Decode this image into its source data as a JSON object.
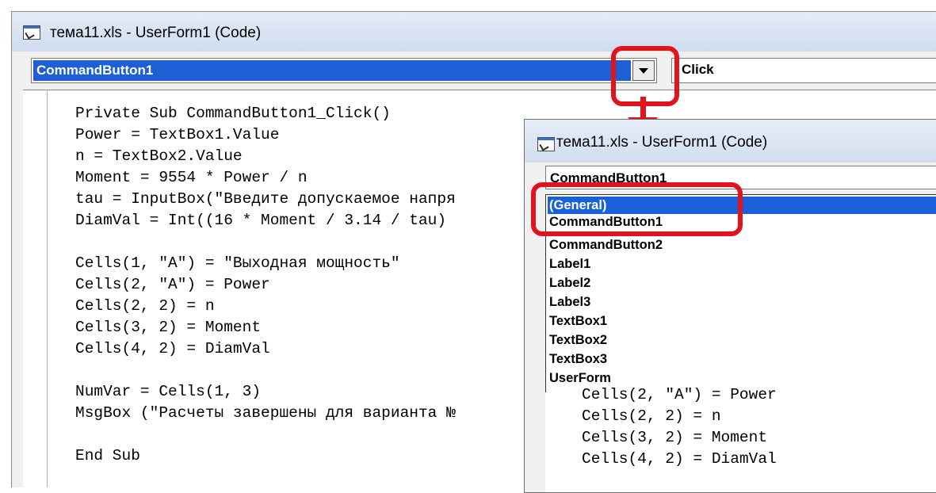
{
  "main_window": {
    "title": "тема11.xls - UserForm1 (Code)",
    "object_combo": {
      "value": "CommandButton1"
    },
    "procedure_combo": {
      "value": "Click"
    },
    "code_lines": [
      "Private Sub CommandButton1_Click()",
      "Power = TextBox1.Value",
      "n = TextBox2.Value",
      "Moment = 9554 * Power / n",
      "tau = InputBox(\"Введите допускаемое напря",
      "DiamVal = Int((16 * Moment / 3.14 / tau)",
      "",
      "Cells(1, \"A\") = \"Выходная мощность\"",
      "Cells(2, \"A\") = Power",
      "Cells(2, 2) = n",
      "Cells(3, 2) = Moment",
      "Cells(4, 2) = DiamVal",
      "",
      "NumVar = Cells(1, 3)",
      "MsgBox (\"Расчеты завершены для варианта №",
      "",
      "End Sub"
    ]
  },
  "popup_window": {
    "title": "тема11.xls - UserForm1 (Code)",
    "object_combo": {
      "value": "CommandButton1"
    },
    "dropdown_items": [
      "(General)",
      "CommandButton1",
      "CommandButton2",
      "Label1",
      "Label2",
      "Label3",
      "TextBox1",
      "TextBox2",
      "TextBox3",
      "UserForm"
    ],
    "selected_item": "(General)",
    "code_lines": [
      "Cells(2, \"A\") = Power",
      "Cells(2, 2) = n",
      "Cells(3, 2) = Moment",
      "Cells(4, 2) = DiamVal"
    ]
  },
  "colors": {
    "selection": "#1f5fd6",
    "highlight": "#e0141d"
  },
  "icons": {
    "window": "vba-code-window-icon",
    "dropdown": "chevron-down-icon"
  }
}
